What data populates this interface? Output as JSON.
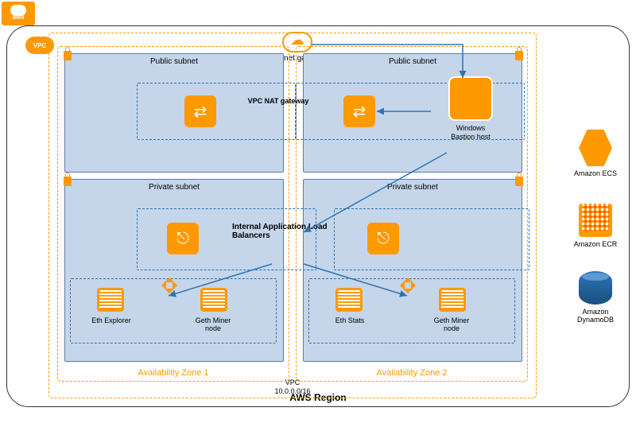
{
  "logo": "aws",
  "region_label": "AWS Region",
  "vpc": {
    "badge": "VPC",
    "cidr_label": "VPC\n10.0.0.0/16"
  },
  "internet_gateway": "Internet gateway",
  "availability_zones": {
    "az1": "Availability Zone 1",
    "az2": "Availability Zone 2"
  },
  "subnets": {
    "public": "Public subnet",
    "private": "Private subnet"
  },
  "nat_label": "VPC NAT gateway",
  "bastion": {
    "line1": "Windows",
    "line2": "Bastion host"
  },
  "load_balancer_label": "Internal Application Load Balancers",
  "nodes": {
    "eth_explorer": "Eth Explorer",
    "geth_miner": "Geth Miner node",
    "eth_stats": "Eth Stats"
  },
  "services": {
    "ecs": "Amazon ECS",
    "ecr": "Amazon ECR",
    "ddb": "Amazon DynamoDB"
  }
}
